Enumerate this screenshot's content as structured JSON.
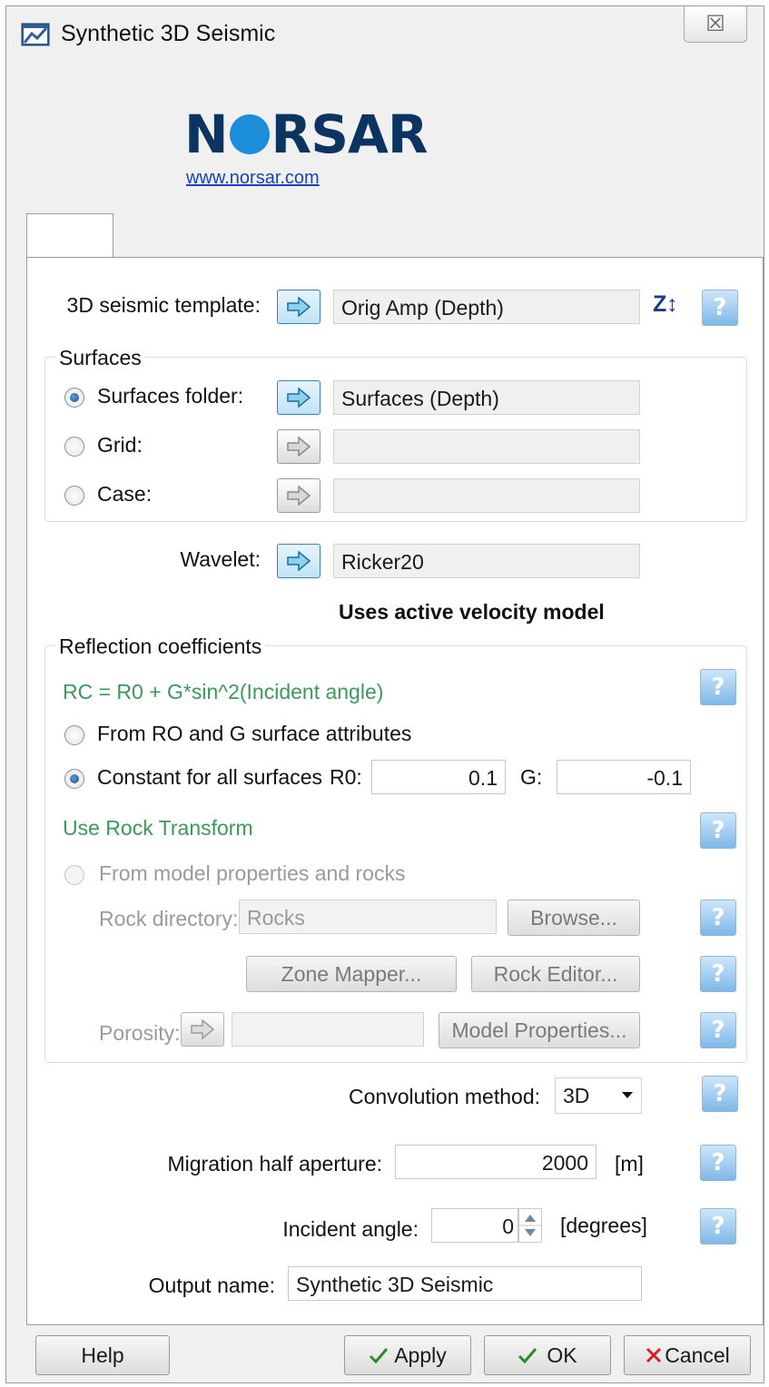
{
  "window": {
    "title": "Synthetic 3D Seismic",
    "close_glyph": "☒",
    "icon": "app-window-icon"
  },
  "logo": {
    "text_before": "N",
    "text_after": "RSAR",
    "link": "www.norsar.com",
    "brand_color": "#0c3460",
    "accent_color": "#1c8ddb"
  },
  "template": {
    "label": "3D seismic template:",
    "value": "Orig Amp (Depth)",
    "domain_icon": "Z↕"
  },
  "surfaces": {
    "title": "Surfaces",
    "folder_label": "Surfaces folder:",
    "folder_value": "Surfaces (Depth)",
    "grid_label": "Grid:",
    "grid_value": "",
    "case_label": "Case:",
    "case_value": ""
  },
  "wavelet": {
    "label": "Wavelet:",
    "value": "Ricker20"
  },
  "velocity_note": "Uses active velocity model",
  "reflection": {
    "title": "Reflection coefficients",
    "formula": "RC = R0 + G*sin^2(Incident angle)",
    "option_attributes": "From RO and G surface attributes",
    "option_constant": "Constant for all surfaces",
    "r0_label": "R0:",
    "r0_value": "0.1",
    "g_label": "G:",
    "g_value": "-0.1",
    "rock_transform": "Use Rock Transform",
    "option_model": "From model properties and rocks",
    "rock_dir_label": "Rock directory:",
    "rock_dir_value": "Rocks",
    "browse": "Browse...",
    "zone_mapper": "Zone Mapper...",
    "rock_editor": "Rock Editor...",
    "porosity_label": "Porosity:",
    "porosity_value": "",
    "model_properties": "Model Properties..."
  },
  "convolution": {
    "label": "Convolution method:",
    "value": "3D"
  },
  "migration": {
    "label": "Migration half aperture:",
    "value": "2000",
    "unit": "[m]"
  },
  "incident": {
    "label": "Incident angle:",
    "value": "0",
    "unit": "[degrees]"
  },
  "output": {
    "label": "Output name:",
    "value": "Synthetic 3D Seismic"
  },
  "footer": {
    "help": "Help",
    "apply": "Apply",
    "ok": "OK",
    "cancel": "Cancel"
  },
  "help_glyph": "?",
  "colors": {
    "help_blue": "#7fb8e8",
    "green_label": "#3a9a5a",
    "check_green": "#2f8a2f",
    "cancel_red": "#d42020"
  }
}
